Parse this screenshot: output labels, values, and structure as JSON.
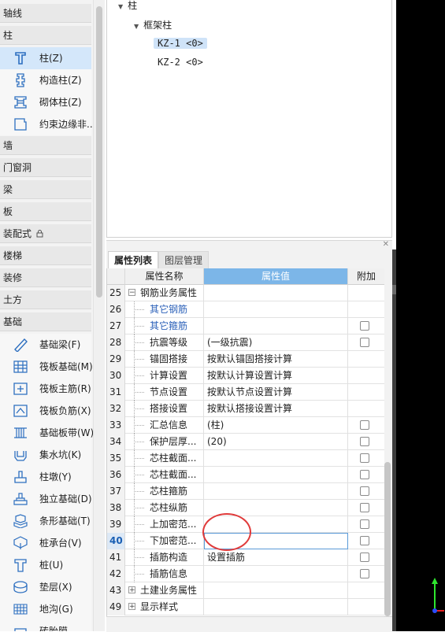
{
  "nav": {
    "categories": {
      "axis": "轴线",
      "column": "柱",
      "wall": "墙",
      "door_window": "门窗洞",
      "beam": "梁",
      "slab": "板",
      "prefab": "装配式",
      "stair": "楼梯",
      "decoration": "装修",
      "earthwork": "土方",
      "foundation": "基础"
    },
    "column_items": [
      "柱(Z)",
      "构造柱(Z)",
      "砌体柱(Z)",
      "约束边缘非..."
    ],
    "foundation_items": [
      "基础梁(F)",
      "筏板基础(M)",
      "筏板主筋(R)",
      "筏板负筋(X)",
      "基础板带(W)",
      "集水坑(K)",
      "柱墩(Y)",
      "独立基础(D)",
      "条形基础(T)",
      "桩承台(V)",
      "桩(U)",
      "垫层(X)",
      "地沟(G)",
      "砖胎膜"
    ]
  },
  "tree": {
    "root": "柱",
    "group": "框架柱",
    "items": [
      "KZ-1 <0>",
      "KZ-2 <0>"
    ]
  },
  "tabs": [
    "属性列表",
    "图层管理"
  ],
  "grid": {
    "headers": [
      "属性名称",
      "属性值",
      "附加"
    ],
    "rows": [
      {
        "num": "25",
        "name": "钢筋业务属性",
        "value": "",
        "check": false
      },
      {
        "num": "26",
        "name": "其它钢筋",
        "value": "",
        "check": false
      },
      {
        "num": "27",
        "name": "其它箍筋",
        "value": "",
        "check": true
      },
      {
        "num": "28",
        "name": "抗震等级",
        "value": "(一级抗震)",
        "check": true
      },
      {
        "num": "29",
        "name": "锚固搭接",
        "value": "按默认锚固搭接计算",
        "check": false
      },
      {
        "num": "30",
        "name": "计算设置",
        "value": "按默认计算设置计算",
        "check": false
      },
      {
        "num": "31",
        "name": "节点设置",
        "value": "按默认节点设置计算",
        "check": false
      },
      {
        "num": "32",
        "name": "搭接设置",
        "value": "按默认搭接设置计算",
        "check": false
      },
      {
        "num": "33",
        "name": "汇总信息",
        "value": "(柱)",
        "check": true
      },
      {
        "num": "34",
        "name": "保护层厚...",
        "value": "(20)",
        "check": true
      },
      {
        "num": "35",
        "name": "芯柱截面...",
        "value": "",
        "check": true
      },
      {
        "num": "36",
        "name": "芯柱截面...",
        "value": "",
        "check": true
      },
      {
        "num": "37",
        "name": "芯柱箍筋",
        "value": "",
        "check": true
      },
      {
        "num": "38",
        "name": "芯柱纵筋",
        "value": "",
        "check": true
      },
      {
        "num": "39",
        "name": "上加密范...",
        "value": "",
        "check": true
      },
      {
        "num": "40",
        "name": "下加密范...",
        "value": "",
        "check": true
      },
      {
        "num": "41",
        "name": "插筋构造",
        "value": "设置插筋",
        "check": true
      },
      {
        "num": "42",
        "name": "插筋信息",
        "value": "",
        "check": true
      },
      {
        "num": "43",
        "name": "土建业务属性",
        "value": "",
        "check": false
      },
      {
        "num": "49",
        "name": "显示样式",
        "value": "",
        "check": false
      }
    ]
  },
  "colors": {
    "selection": "#d4e7fa",
    "header_highlight": "#7cb6e8",
    "link_blue": "#2d62b9",
    "annotation_red": "#e03a3a"
  }
}
